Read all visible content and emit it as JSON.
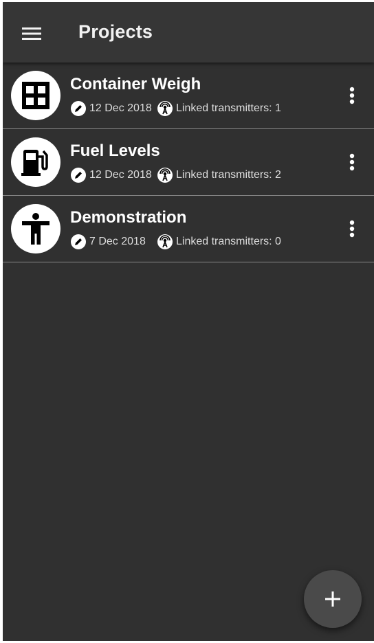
{
  "app_bar": {
    "title": "Projects",
    "menu_icon": "menu-icon"
  },
  "projects": [
    {
      "name": "Container Weigh",
      "icon": "grid-icon",
      "edited": "12 Dec 2018",
      "transmitters": "Linked transmitters: 1"
    },
    {
      "name": "Fuel Levels",
      "icon": "fuel-pump-icon",
      "edited": "12 Dec 2018",
      "transmitters": "Linked transmitters: 2"
    },
    {
      "name": "Demonstration",
      "icon": "person-icon",
      "edited": "7 Dec 2018",
      "transmitters": "Linked transmitters: 0"
    }
  ],
  "fab": {
    "icon": "plus-icon",
    "label": "+"
  },
  "colors": {
    "background": "#303030",
    "app_bar": "#363636",
    "text_primary": "#ffffff",
    "text_secondary": "#dcdcdc",
    "divider": "#8a8a8a",
    "fab": "#4a4a4a"
  }
}
